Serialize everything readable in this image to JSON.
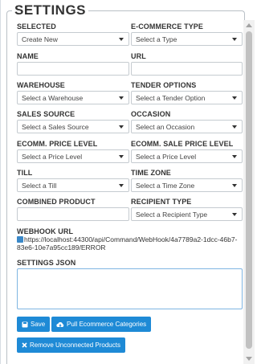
{
  "legend": "SETTINGS",
  "fields": {
    "selected": {
      "label": "SELECTED",
      "value": "Create New"
    },
    "ecommerce_type": {
      "label": "E-COMMERCE TYPE",
      "value": "Select a Type"
    },
    "name": {
      "label": "NAME",
      "value": ""
    },
    "url": {
      "label": "URL",
      "value": ""
    },
    "warehouse": {
      "label": "WAREHOUSE",
      "value": "Select a Warehouse"
    },
    "tender_options": {
      "label": "TENDER OPTIONS",
      "value": "Select a Tender Option"
    },
    "sales_source": {
      "label": "SALES SOURCE",
      "value": "Select a Sales Source"
    },
    "occasion": {
      "label": "OCCASION",
      "value": "Select an Occasion"
    },
    "ecomm_price_level": {
      "label": "ECOMM. PRICE LEVEL",
      "value": "Select a Price Level"
    },
    "ecomm_sale_price_level": {
      "label": "ECOMM. SALE PRICE LEVEL",
      "value": "Select a Price Level"
    },
    "till": {
      "label": "TILL",
      "value": "Select a Till"
    },
    "time_zone": {
      "label": "TIME ZONE",
      "value": "Select a Time Zone"
    },
    "combined_product": {
      "label": "COMBINED PRODUCT",
      "value": ""
    },
    "recipient_type": {
      "label": "RECIPIENT TYPE",
      "value": "Select a Recipient Type"
    }
  },
  "webhook": {
    "label": "WEBHOOK URL",
    "url": "https://localhost:44300/api/Command/WebHook/4a7789a2-1dcc-46b7-83e6-10e7a95cc189/ERROR"
  },
  "settings_json": {
    "label": "SETTINGS JSON",
    "value": ""
  },
  "buttons": {
    "save": "Save",
    "pull_categories": "Pull Ecommerce Categories",
    "remove_unconnected": "Remove Unconnected Products"
  },
  "colors": {
    "primary_button": "#1e8ad6",
    "textarea_focus_border": "#7fb5e2"
  }
}
